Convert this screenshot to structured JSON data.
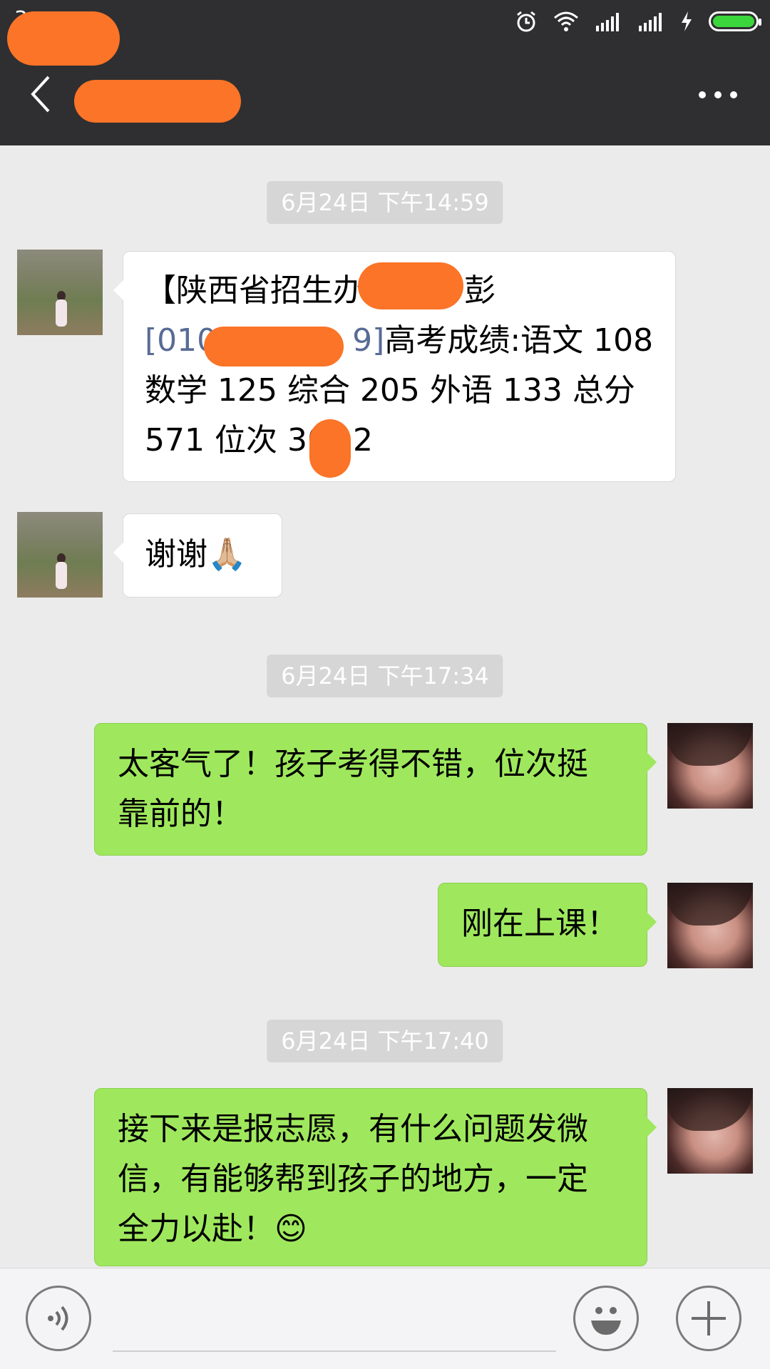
{
  "status_bar": {
    "left_text": "3",
    "colors": {
      "battery": "#3bd63b"
    }
  },
  "header": {
    "title": "",
    "back_icon": "chevron-left-icon",
    "more_icon": "more-dots-icon"
  },
  "chat": {
    "messages": [
      {
        "type": "time",
        "text": "6月24日 下午14:59"
      },
      {
        "type": "incoming",
        "line1": "【陕西省招生办",
        "line1b": "彭",
        "line2_link": "[010",
        "line2_link_end": "9]",
        "line2_rest": "高考成绩:语文 108",
        "line3": "数学 125 综合 205 外语 133 总分",
        "line4": "571 位次 30",
        "line4_end": "2"
      },
      {
        "type": "incoming",
        "text": "谢谢",
        "emoji": "🙏🏼"
      },
      {
        "type": "time",
        "text": "6月24日 下午17:34"
      },
      {
        "type": "outgoing",
        "line1": "太客气了！孩子考得不错，位次挺",
        "line2": "靠前的！"
      },
      {
        "type": "outgoing",
        "text": "刚在上课！"
      },
      {
        "type": "time",
        "text": "6月24日 下午17:40"
      },
      {
        "type": "outgoing",
        "line1": "接下来是报志愿，有什么问题发微",
        "line2": "信，有能够帮到孩子的地方，一定",
        "line3": "全力以赴！",
        "emoji": "😊"
      }
    ]
  },
  "input_bar": {
    "voice_icon": "voice-icon",
    "emoji_icon": "emoji-face-icon",
    "add_icon": "plus-icon",
    "colors": {
      "outgoing_bubble": "#9fe85d",
      "incoming_bubble": "#ffffff"
    }
  }
}
